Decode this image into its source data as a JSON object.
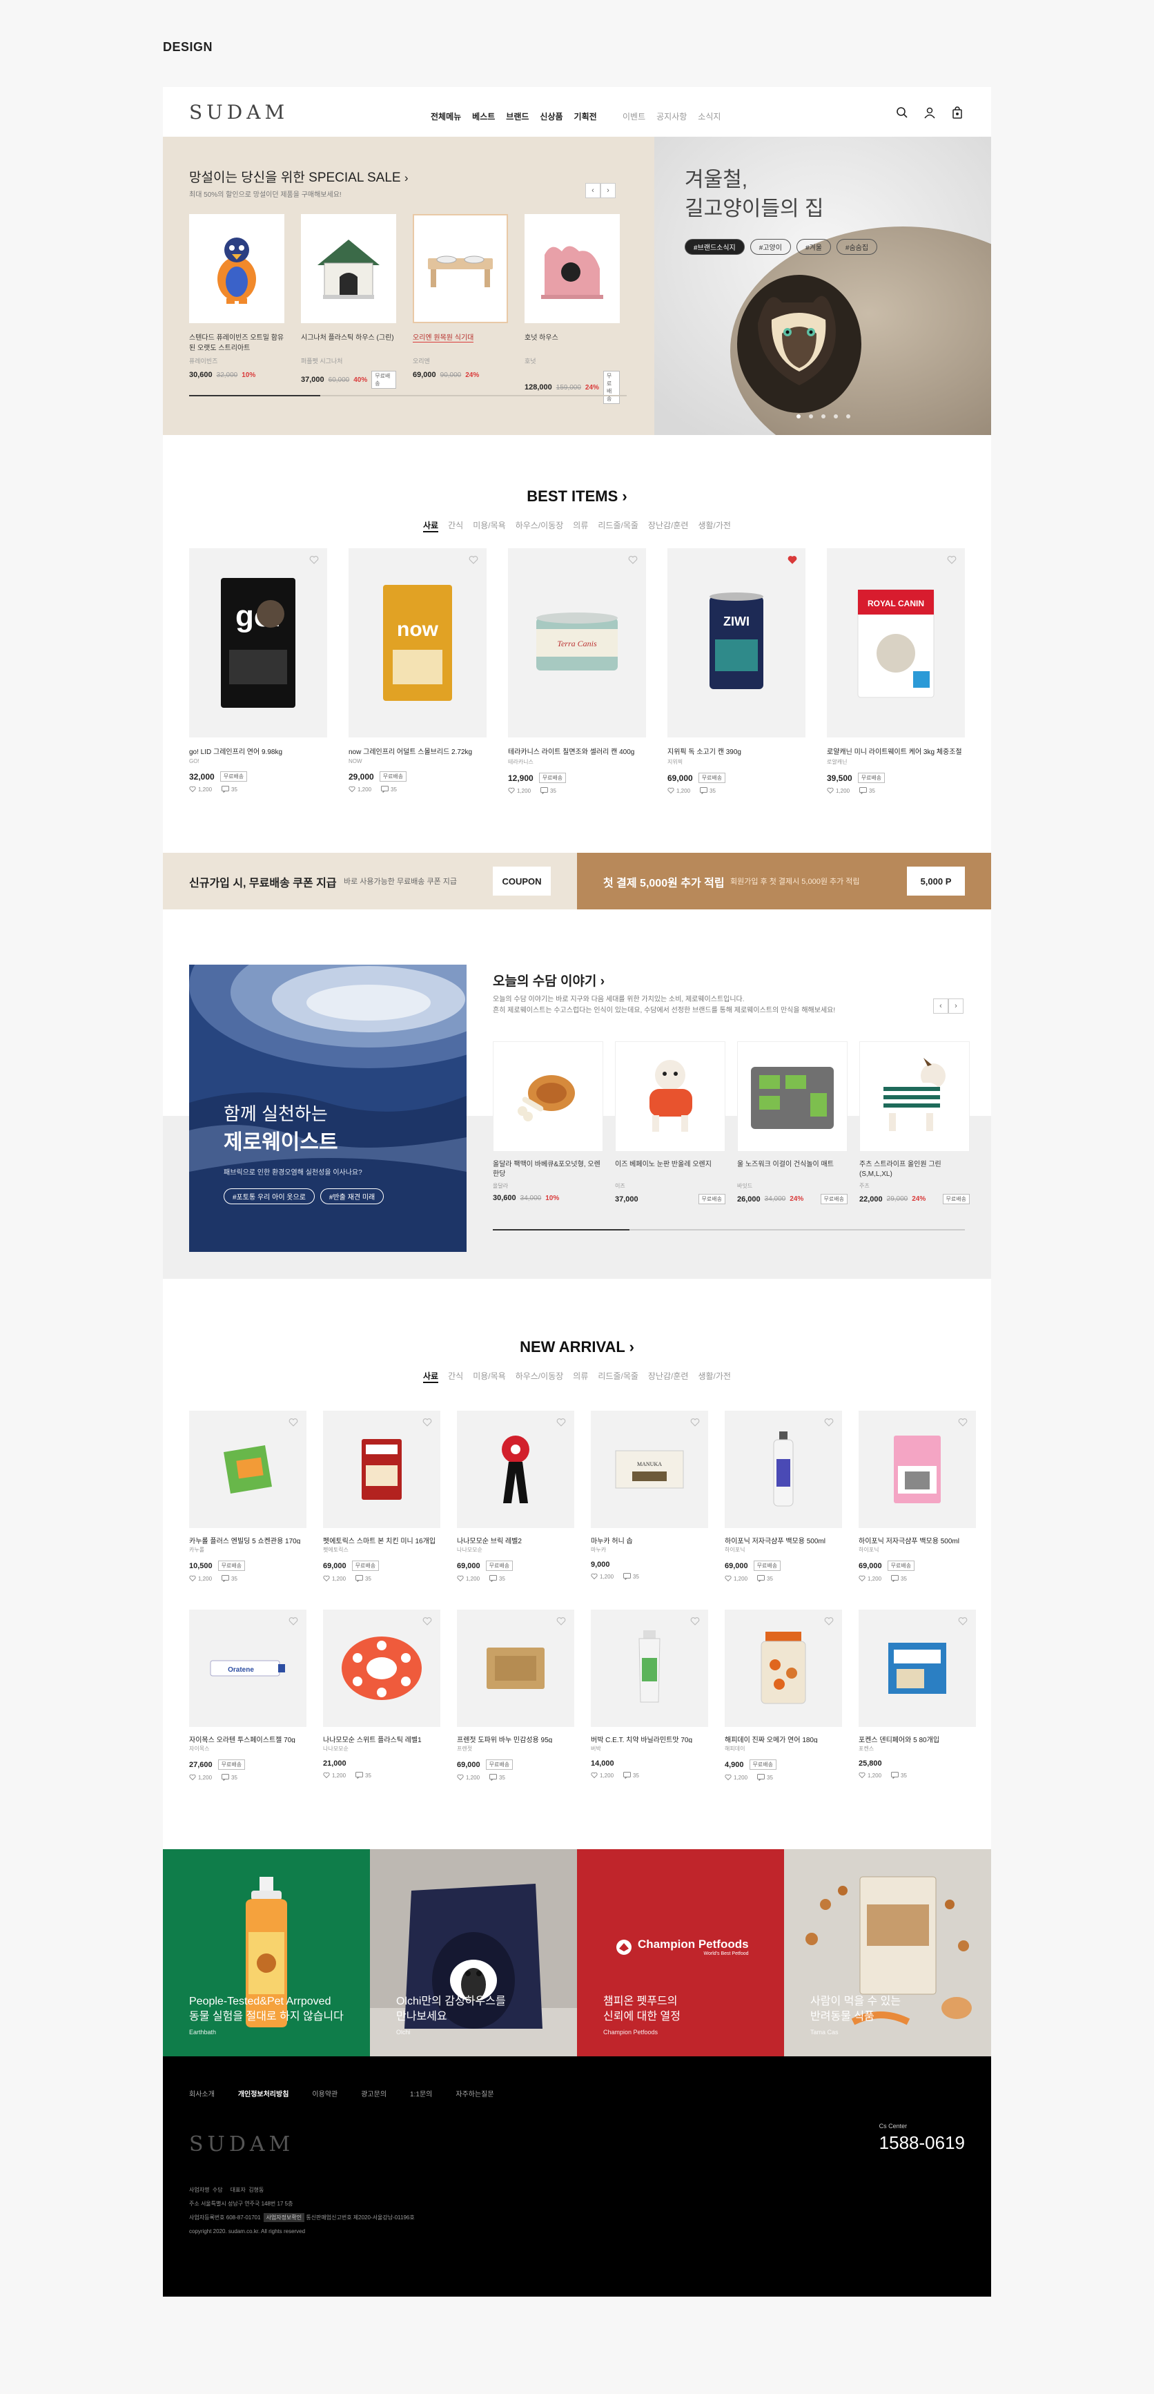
{
  "design_label": "DESIGN",
  "header": {
    "logo": "SUDAM",
    "nav": [
      "전체메뉴",
      "베스트",
      "브랜드",
      "신상품",
      "기획전"
    ],
    "nav_secondary": [
      "이벤트",
      "공지사항",
      "소식지"
    ]
  },
  "sale": {
    "title": "망설이는 당신을 위한 SPECIAL SALE",
    "subtitle": "최대 50%의 할인으로 망설이던 제품을 구매해보세요!",
    "items": [
      {
        "name": "스텐다드 퓨레이빈즈 오트밀 함유된 오랫도 스트리아트",
        "brand": "퓨레이빈즈",
        "price": "30,600",
        "old": "32,000",
        "pct": "10%",
        "badge": ""
      },
      {
        "name": "시그나처 플라스틱 하우스 (그린)",
        "brand": "퍼플펫 시그나처",
        "price": "37,000",
        "old": "60,000",
        "pct": "40%",
        "badge": "무료배송"
      },
      {
        "name": "오리엔 원목원 식기대",
        "brand": "오리엔",
        "price": "69,000",
        "old": "90,000",
        "pct": "24%",
        "badge": ""
      },
      {
        "name": "호넛 하우스",
        "brand": "호넛",
        "price": "128,000",
        "old": "159,000",
        "pct": "24%",
        "badge": "무료배송"
      }
    ],
    "progress": 0.3
  },
  "hero": {
    "line1": "겨울철,",
    "line2": "길고양이들의 집",
    "tags": [
      "#브랜드소식지",
      "#고양이",
      "#겨울",
      "#숨숨집"
    ]
  },
  "best": {
    "title": "BEST ITEMS",
    "cats": [
      "사료",
      "간식",
      "미용/목욕",
      "하우스/이동장",
      "의류",
      "리드줄/목줄",
      "장난감/훈련",
      "생활/가전"
    ],
    "items": [
      {
        "name": "go! LID 그레인프리 연어 9.98kg",
        "brand": "GO!",
        "price": "32,000",
        "badge": "무료배송",
        "likes": "1,200",
        "reviews": "35",
        "liked": false
      },
      {
        "name": "now 그레인프리 어덜트 스몰브리드 2.72kg",
        "brand": "NOW",
        "price": "29,000",
        "badge": "무료배송",
        "likes": "1,200",
        "reviews": "35",
        "liked": false
      },
      {
        "name": "테라카니스 라이트 칠면조와 셀러리 캔 400g",
        "brand": "테라카니스",
        "price": "12,900",
        "badge": "무료배송",
        "likes": "1,200",
        "reviews": "35",
        "liked": false
      },
      {
        "name": "지위픽 독 소고기 캔 390g",
        "brand": "지위픽",
        "price": "69,000",
        "badge": "무료배송",
        "likes": "1,200",
        "reviews": "35",
        "liked": true
      },
      {
        "name": "로얄캐닌 미니 라이트웨이트 케어 3kg 체중조절",
        "brand": "로얄캐닌",
        "price": "39,500",
        "badge": "무료배송",
        "likes": "1,200",
        "reviews": "35",
        "liked": false
      }
    ]
  },
  "coupon": {
    "left_title": "신규가입 시, 무료배송 쿠폰 지급",
    "left_desc": "바로 사용가능한 무료배송 쿠폰 지급",
    "left_btn": "COUPON",
    "right_title": "첫 결제 5,000원 추가 적립",
    "right_desc": "회원가입 후 첫 결제시 5,000원 추가 적립",
    "right_btn": "5,000 P"
  },
  "story": {
    "title": "오늘의 수담 이야기",
    "sub1": "오늘의 수담 이야기는 바로 지구와 다음 세대를 위한 가치있는 소비, 제로웨이스트입니다.",
    "sub2": "흔히 제로웨이스트는 수고스럽다는 인식이 있는데요, 수담에서 선정한 브랜드를 통해 제로웨이스트의 만식을 해해보세요!",
    "image_line1": "함께 실천하는",
    "image_line2": "제로웨이스트",
    "image_sub": "패브릭으로 인한 환경오염해 실천성을 이사나요?",
    "image_tags": [
      "#포토통 우리 아이 옷으로",
      "#반출 재견 미래"
    ],
    "items": [
      {
        "name": "올달라 팩맥이 바베큐&포오넛형, 오렌 한당",
        "brand": "올달라",
        "price": "30,600",
        "old": "34,000",
        "pct": "10%",
        "badge": ""
      },
      {
        "name": "이즈 베페이노 눈판 반올레 오렌지",
        "brand": "이즈",
        "price": "37,000",
        "old": "",
        "pct": "",
        "badge": "무료배송"
      },
      {
        "name": "울 노즈워크 이걸이 건식놀이 매트",
        "brand": "바잇드",
        "price": "26,000",
        "old": "34,000",
        "pct": "24%",
        "badge": "무료배송"
      },
      {
        "name": "주츠 스트라이프 올인원 그린 (S,M,L,XL)",
        "brand": "주츠",
        "price": "22,000",
        "old": "29,000",
        "pct": "24%",
        "badge": "무료배송"
      }
    ]
  },
  "new_arrival": {
    "title": "NEW ARRIVAL",
    "cats": [
      "사료",
      "간식",
      "미용/목욕",
      "하우스/이동장",
      "의류",
      "리드줄/목줄",
      "장난감/훈련",
      "생활/가전"
    ],
    "row1": [
      {
        "name": "카누롤 플러스 엔빌딩 5 쇼켄관용 170g",
        "brand": "카누롤",
        "price": "10,500",
        "badge": "무료배송",
        "likes": "1,200",
        "reviews": "35"
      },
      {
        "name": "펫에토릭스 스마트 본 치킨 미니 16개입",
        "brand": "펫에토릭스",
        "price": "69,000",
        "badge": "무료배송",
        "likes": "1,200",
        "reviews": "35"
      },
      {
        "name": "나나모모순 브릭 레벨2",
        "brand": "나나모모순",
        "price": "69,000",
        "badge": "무료배송",
        "likes": "1,200",
        "reviews": "35"
      },
      {
        "name": "마누카 허니 솝",
        "brand": "마누카",
        "price": "9,000",
        "badge": "",
        "likes": "1,200",
        "reviews": "35"
      },
      {
        "name": "하이포닉 저자극샴푸 백모용 500ml",
        "brand": "하이포닉",
        "price": "69,000",
        "badge": "무료배송",
        "likes": "1,200",
        "reviews": "35"
      },
      {
        "name": "하이포닉 저자극샴푸 백모용 500ml",
        "brand": "하이포닉",
        "price": "69,000",
        "badge": "무료배송",
        "likes": "1,200",
        "reviews": "35"
      }
    ],
    "row2": [
      {
        "name": "자이목스 오라텐 투스페이스트젤 70g",
        "brand": "자이목스",
        "price": "27,600",
        "badge": "무료배송",
        "likes": "1,200",
        "reviews": "35"
      },
      {
        "name": "나나모모순 스위트 플라스틱 레벨1",
        "brand": "나나모모순",
        "price": "21,000",
        "badge": "",
        "likes": "1,200",
        "reviews": "35"
      },
      {
        "name": "프렌젓 도파위 바누 민감성용 95g",
        "brand": "프렌젓",
        "price": "69,000",
        "badge": "무료배송",
        "likes": "1,200",
        "reviews": "35"
      },
      {
        "name": "버박 C.E.T. 치약 바닐라민트맛 70g",
        "brand": "버박",
        "price": "14,000",
        "badge": "",
        "likes": "1,200",
        "reviews": "35"
      },
      {
        "name": "해피데이 진짜 오메가 연어 180g",
        "brand": "해피데이",
        "price": "4,900",
        "badge": "무료배송",
        "likes": "1,200",
        "reviews": "35"
      },
      {
        "name": "포켄스 덴티페어와 5 80개입",
        "brand": "포켄스",
        "price": "25,800",
        "badge": "",
        "likes": "1,200",
        "reviews": "35"
      }
    ]
  },
  "brands": [
    {
      "line1": "People-Tested&Pet Arrpoved",
      "line2": "동물 실험을 절대로 하지 않습니다",
      "sub": "Earthbath",
      "color": "#0f7d4a"
    },
    {
      "line1": "Olchi만의 감성하우스를",
      "line2": "만나보세요",
      "sub": "Olchi",
      "color": "#8a8782"
    },
    {
      "line1": "챔피온 펫푸드의",
      "line2": "신뢰에 대한 열정",
      "sub": "Champion Petfoods",
      "logo": "Champion Petfoods",
      "logo_sub": "World's Best Petfood",
      "color": "#c0252b"
    },
    {
      "line1": "사람이 먹을 수 있는",
      "line2": "반려동물 식품",
      "sub": "Tama Cas",
      "color": "#d4cfc8"
    }
  ],
  "footer": {
    "nav": [
      "회사소개",
      "개인정보처리방침",
      "이용약관",
      "광고문의",
      "1:1문의",
      "자주하는질문"
    ],
    "logo": "SUDAM",
    "cs_label": "Cs Center",
    "cs_number": "1588-0619",
    "info1": "사업자명  수담     대표자  김형동",
    "info2": "주소  서울특별시 성남구 연주국 148번 17 5층",
    "info3": "사업자등록번호 608-87-01701",
    "info3_box": "사업자정보확인",
    "info3_b": "통신판매업신고번호 제2020-서울강남-01196호",
    "copyright": "copyright 2020. sudam.co.kr. All rights reserved"
  }
}
